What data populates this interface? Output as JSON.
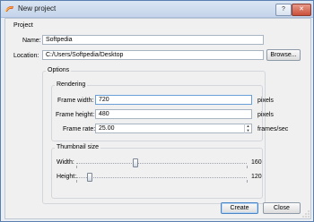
{
  "window": {
    "title": "New project",
    "help_label": "?",
    "close_label": "✕"
  },
  "project": {
    "group_title": "Project",
    "name_label": "Name:",
    "name_value": "Softpedia",
    "location_label": "Location:",
    "location_value": "C:/Users/Softpedia/Desktop",
    "browse_label": "Browse..."
  },
  "options": {
    "group_title": "Options",
    "rendering": {
      "group_title": "Rendering",
      "width_label": "Frame width:",
      "width_value": "720",
      "width_unit": "pixels",
      "height_label": "Frame height:",
      "height_value": "480",
      "height_unit": "pixels",
      "rate_label": "Frame rate:",
      "rate_value": "25.00",
      "rate_unit": "frames/sec"
    },
    "thumbnail": {
      "group_title": "Thumbnail size",
      "width_label": "Width:",
      "width_value": "160",
      "height_label": "Height:",
      "height_value": "120"
    }
  },
  "buttons": {
    "create_label": "Create",
    "close_label": "Close"
  },
  "colors": {
    "accent": "#4a86c5",
    "title_bar": "#c4d4ea"
  }
}
